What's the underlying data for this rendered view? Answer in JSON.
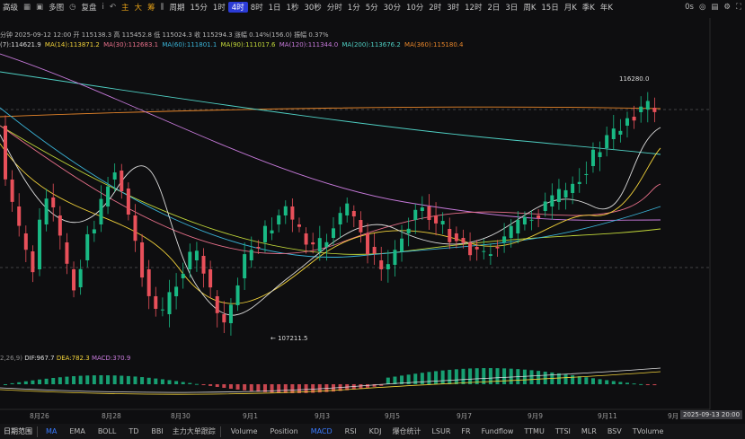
{
  "toolbar": {
    "left_label": "高级",
    "icons": [
      "layout-icon",
      "picture-icon",
      "multi-chart-icon",
      "dropdown-icon"
    ],
    "multi_label": "多图",
    "replay_label": "复盘",
    "i_label": "i",
    "indicator_tags": [
      "主",
      "大",
      "筹"
    ],
    "period_label": "周期",
    "periods": [
      "15分",
      "1时",
      "4时",
      "8时",
      "1日",
      "1秒",
      "30秒",
      "分时",
      "1分",
      "5分",
      "30分",
      "10分",
      "2时",
      "3时",
      "12时",
      "2日",
      "3日",
      "周K",
      "15日",
      "月K",
      "季K",
      "年K"
    ],
    "active_period": "4时",
    "right_label": "0s"
  },
  "info": "分钟 2025-09-12 12:00 开 115138.3 高 115452.8 低 115024.3 收 115294.3 涨幅 0.14%(156.0) 振幅 0.37%",
  "ma_line": {
    "prefix": "(7):114621.9",
    "items": [
      {
        "label": "MA(14):113871.2",
        "color": "#f2d23a"
      },
      {
        "label": "MA(30):112683.1",
        "color": "#e8708a"
      },
      {
        "label": "MA(60):111801.1",
        "color": "#3ab4d8"
      },
      {
        "label": "MA(90):111017.6",
        "color": "#c3d93a"
      },
      {
        "label": "MA(120):111344.0",
        "color": "#c77adb"
      },
      {
        "label": "MA(200):113676.2",
        "color": "#4fd0c4"
      },
      {
        "label": "MA(360):115180.4",
        "color": "#e8862a"
      }
    ]
  },
  "price_labels": {
    "high": "116280.0",
    "low": "107211.5"
  },
  "macd": {
    "params": "2,26,9)",
    "dif": "DIF:967.7",
    "dea": "DEA:782.3",
    "macd": "MACD:370.9"
  },
  "dates": [
    "8月26",
    "8月28",
    "8月30",
    "9月1",
    "9月3",
    "9月5",
    "9月7",
    "9月9",
    "9月11",
    "9月"
  ],
  "time_box": "2025-09-13 20:00",
  "bottom_bar": {
    "left_label": "日期范围",
    "items": [
      "MA",
      "EMA",
      "BOLL",
      "TD",
      "BBI",
      "主力大单跟踪",
      "Volume",
      "Position",
      "MACD",
      "RSI",
      "KDJ",
      "爆仓统计",
      "LSUR",
      "FR",
      "Fundflow",
      "TTMU",
      "TTSI",
      "MLR",
      "BSV",
      "TVolume"
    ],
    "selected": [
      "MA",
      "MACD"
    ]
  },
  "colors": {
    "up": "#19b984",
    "down": "#e8505a",
    "bg": "#0e0e10",
    "accent": "#2b3bd6"
  }
}
